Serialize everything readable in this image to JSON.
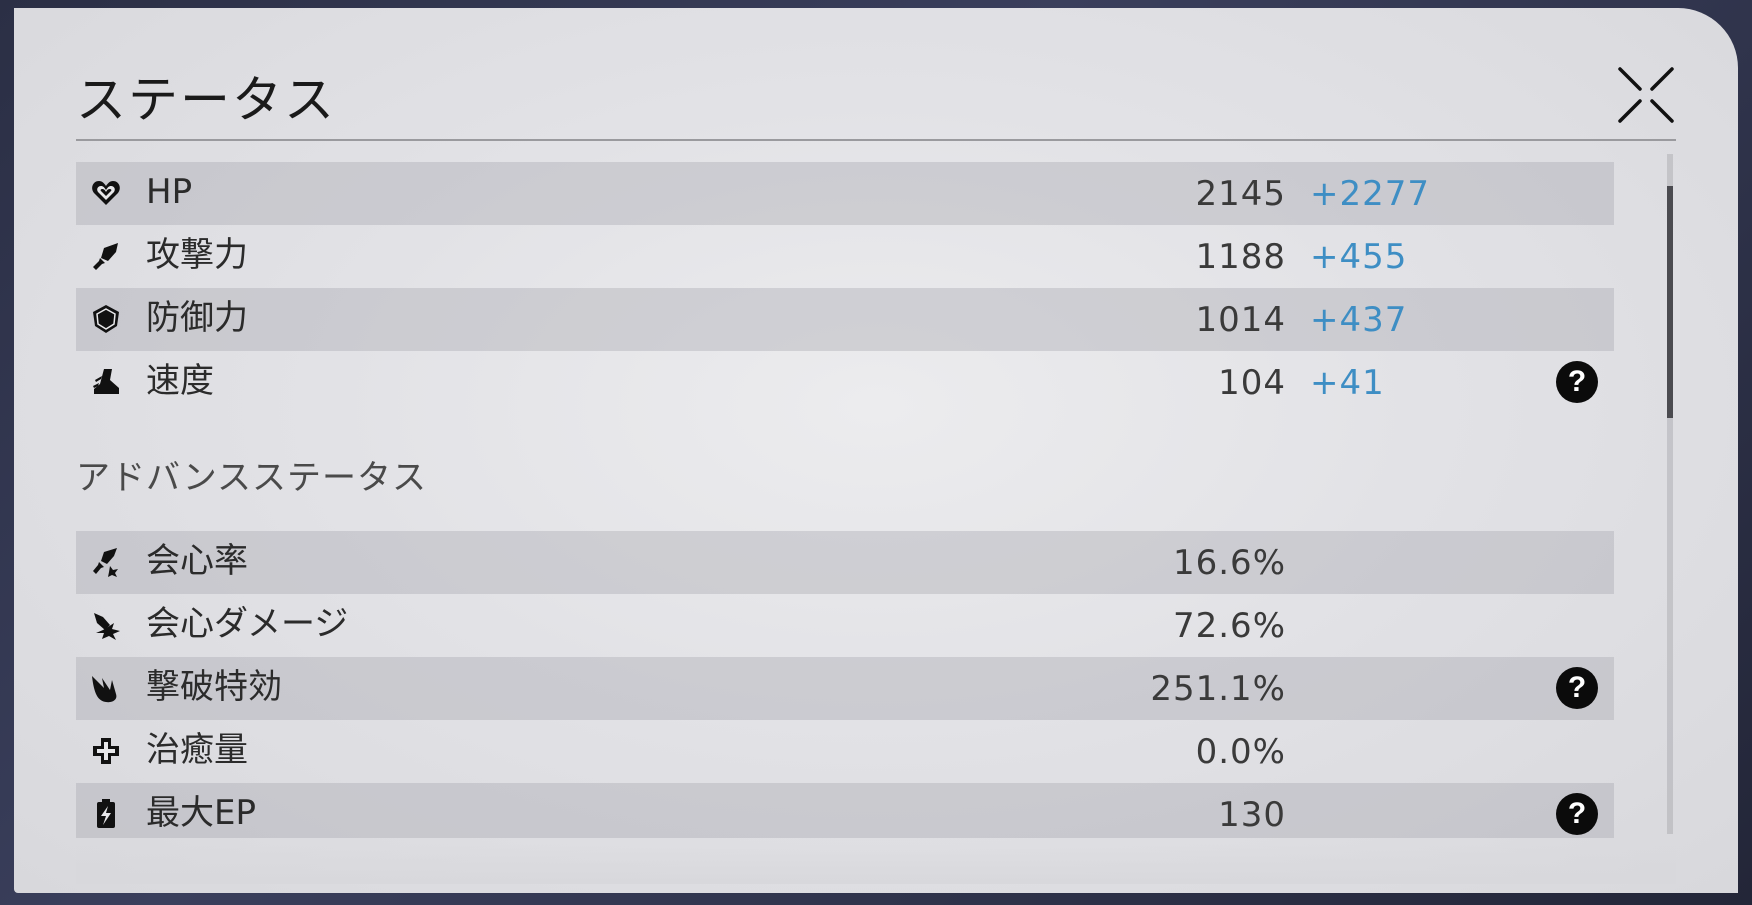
{
  "title": "ステータス",
  "close_icon": "close-x-icon",
  "advanced_title": "アドバンスステータス",
  "basic_stats": [
    {
      "icon": "heart-icon",
      "label": "HP",
      "base": "2145",
      "bonus": "+2277"
    },
    {
      "icon": "sword-icon",
      "label": "攻撃力",
      "base": "1188",
      "bonus": "+455"
    },
    {
      "icon": "shield-icon",
      "label": "防御力",
      "base": "1014",
      "bonus": "+437"
    },
    {
      "icon": "boot-icon",
      "label": "速度",
      "base": "104",
      "bonus": "+41",
      "help": "?"
    }
  ],
  "advanced_stats": [
    {
      "icon": "crit-rate-icon",
      "label": "会心率",
      "base": "16.6%"
    },
    {
      "icon": "crit-damage-icon",
      "label": "会心ダメージ",
      "base": "72.6%"
    },
    {
      "icon": "break-effect-icon",
      "label": "撃破特効",
      "base": "251.1%",
      "help": "?"
    },
    {
      "icon": "healing-cross-icon",
      "label": "治癒量",
      "base": "0.0%"
    },
    {
      "icon": "battery-icon",
      "label": "最大EP",
      "base": "130",
      "help": "?"
    }
  ],
  "colors": {
    "bonus": "#3e8ec4",
    "help_bg": "#0b0b0b",
    "panel": "#e2e2e6"
  }
}
